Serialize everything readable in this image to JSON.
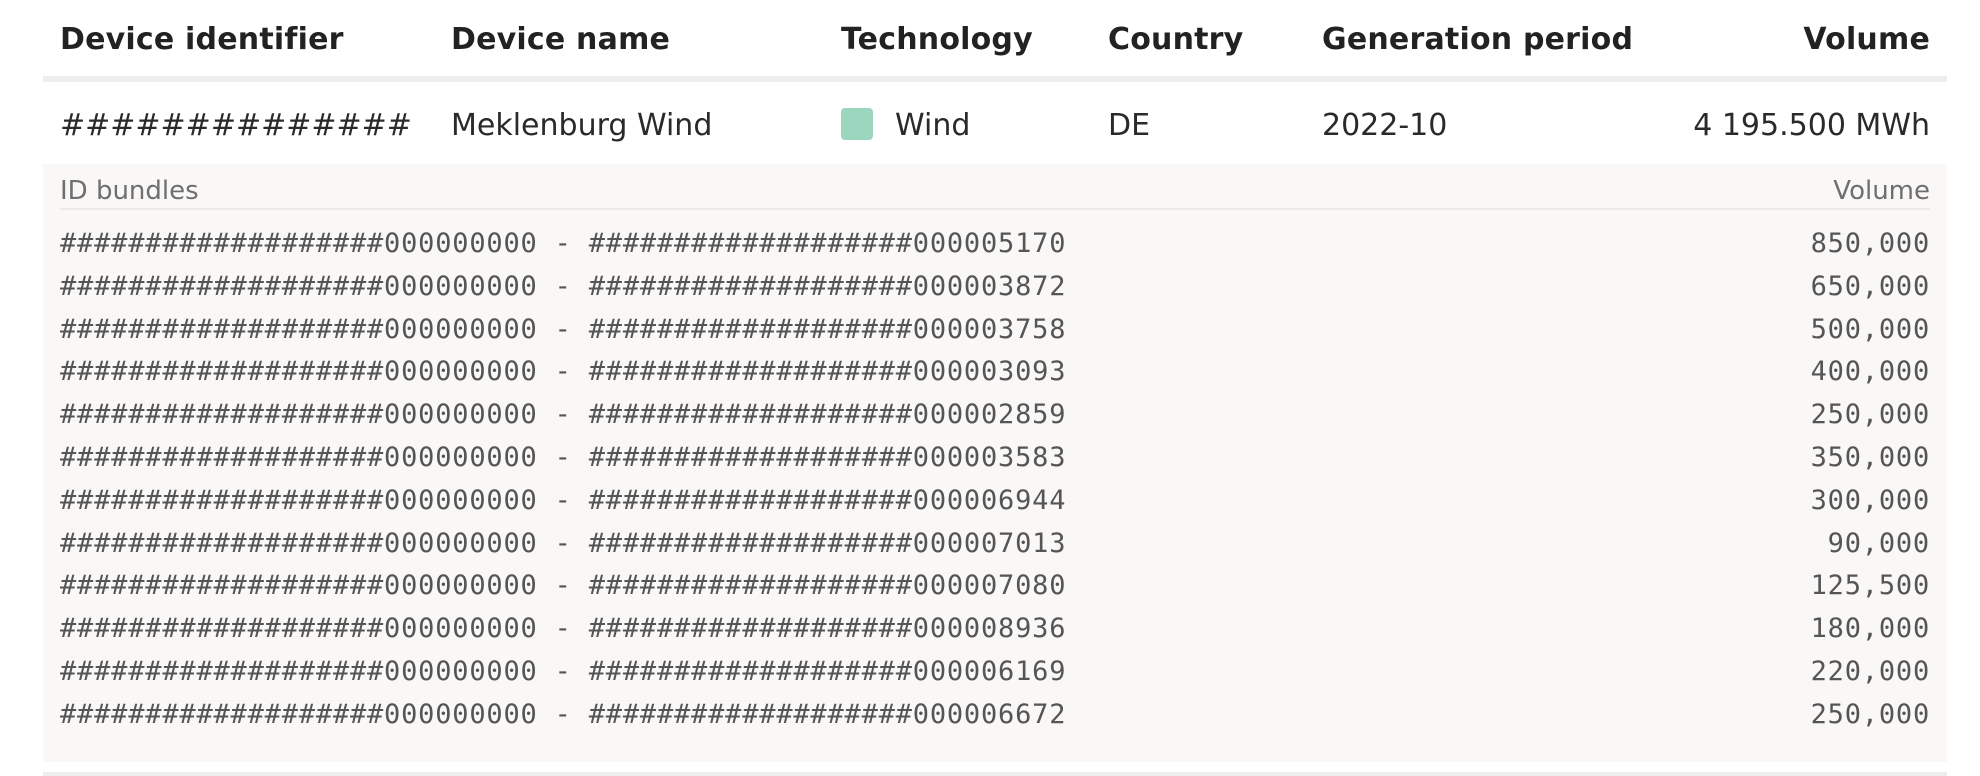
{
  "table": {
    "headers": {
      "device_identifier": "Device identifier",
      "device_name": "Device name",
      "technology": "Technology",
      "country": "Country",
      "generation_period": "Generation period",
      "volume": "Volume"
    },
    "row": {
      "device_identifier": "##############",
      "device_name": "Meklenburg Wind",
      "technology": "Wind",
      "technology_color": "#9dd6be",
      "country": "DE",
      "generation_period": "2022-10",
      "volume": "4 195.500 MWh"
    },
    "bundles": {
      "header_label": "ID bundles",
      "volume_label": "Volume",
      "items": [
        {
          "range": "###################000000000 - ###################000005170",
          "volume": "850,000"
        },
        {
          "range": "###################000000000 - ###################000003872",
          "volume": "650,000"
        },
        {
          "range": "###################000000000 - ###################000003758",
          "volume": "500,000"
        },
        {
          "range": "###################000000000 - ###################000003093",
          "volume": "400,000"
        },
        {
          "range": "###################000000000 - ###################000002859",
          "volume": "250,000"
        },
        {
          "range": "###################000000000 - ###################000003583",
          "volume": "350,000"
        },
        {
          "range": "###################000000000 - ###################000006944",
          "volume": "300,000"
        },
        {
          "range": "###################000000000 - ###################000007013",
          "volume": "90,000"
        },
        {
          "range": "###################000000000 - ###################000007080",
          "volume": "125,500"
        },
        {
          "range": "###################000000000 - ###################000008936",
          "volume": "180,000"
        },
        {
          "range": "###################000000000 - ###################000006169",
          "volume": "220,000"
        },
        {
          "range": "###################000000000 - ###################000006672",
          "volume": "250,000"
        }
      ]
    }
  }
}
